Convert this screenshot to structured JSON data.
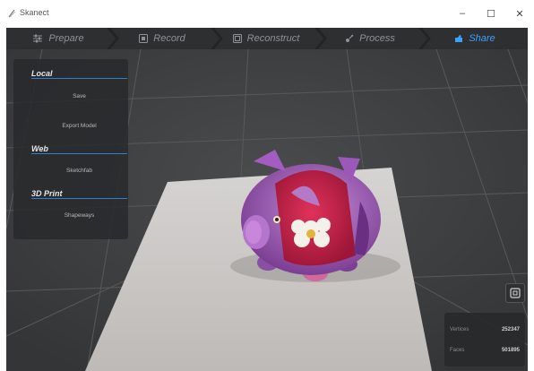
{
  "window": {
    "title": "Skanect",
    "controls": {
      "minimize": "–",
      "maximize": "☐",
      "close": "✕"
    }
  },
  "tabs": [
    {
      "label": "Prepare",
      "icon": "sliders-icon"
    },
    {
      "label": "Record",
      "icon": "record-icon"
    },
    {
      "label": "Reconstruct",
      "icon": "cube-icon"
    },
    {
      "label": "Process",
      "icon": "process-icon"
    },
    {
      "label": "Share",
      "icon": "share-icon",
      "active": true
    }
  ],
  "panel": {
    "local": {
      "title": "Local",
      "items": [
        "Save",
        "Export Model"
      ]
    },
    "web": {
      "title": "Web",
      "items": [
        "Sketchfab"
      ]
    },
    "print": {
      "title": "3D Print",
      "items": [
        "Shapeways"
      ]
    }
  },
  "stats": {
    "vertices_label": "Vertices",
    "vertices_value": "252347",
    "faces_label": "Faces",
    "faces_value": "501895"
  },
  "colors": {
    "accent": "#3ba0ff",
    "tabbar": "#2e2f31",
    "viewport": "#3e3f41",
    "grid": "#5a5b5d"
  }
}
